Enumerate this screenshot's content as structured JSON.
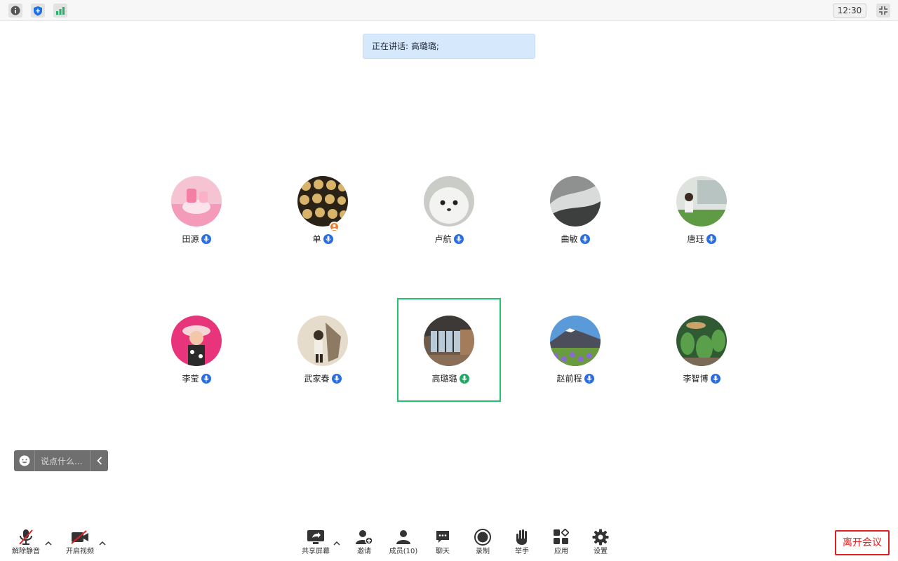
{
  "topbar": {
    "icons": [
      "info-icon",
      "shield-icon",
      "signal-icon"
    ],
    "time": "12:30"
  },
  "banner": {
    "text": "正在讲话: 高璐璐;"
  },
  "participants": [
    {
      "name": "田源",
      "mic": "mic-icon",
      "avatar": "pink-dessert"
    },
    {
      "name": "单",
      "mic": "mic-icon",
      "avatar": "biscuits",
      "host": true
    },
    {
      "name": "卢航",
      "mic": "mic-icon",
      "avatar": "white-seal"
    },
    {
      "name": "曲敏",
      "mic": "mic-icon",
      "avatar": "waterfall"
    },
    {
      "name": "唐珏",
      "mic": "mic-icon",
      "avatar": "person-outdoor"
    },
    {
      "name": "李莹",
      "mic": "mic-icon",
      "avatar": "girl-pink"
    },
    {
      "name": "武家春",
      "mic": "mic-icon",
      "avatar": "rider"
    },
    {
      "name": "高璐璐",
      "mic": "mic-icon",
      "avatar": "room-window",
      "speaking": true
    },
    {
      "name": "赵前程",
      "mic": "mic-icon",
      "avatar": "mountain-flowers"
    },
    {
      "name": "李智博",
      "mic": "mic-icon",
      "avatar": "garden-plants"
    }
  ],
  "chat_quick": {
    "placeholder": "说点什么..."
  },
  "toolbar": {
    "unmute": "解除静音",
    "start_video": "开启视频",
    "share_screen": "共享屏幕",
    "invite": "邀请",
    "members": "成员(10)",
    "chat": "聊天",
    "record": "录制",
    "raise_hand": "举手",
    "apps": "应用",
    "settings": "设置"
  },
  "leave_button": "离开会议",
  "colors": {
    "active_border": "#23c36b",
    "mic_blue": "#2a6de0",
    "leave_red": "#e02020",
    "banner_bg": "#d6e8fb"
  }
}
